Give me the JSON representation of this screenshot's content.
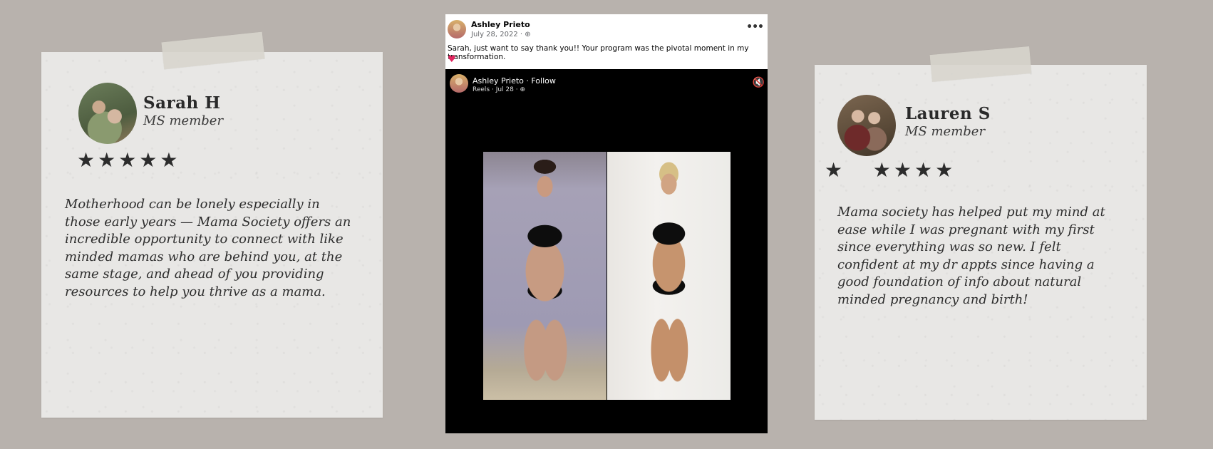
{
  "left_card": {
    "name": "Sarah H",
    "role": "MS member",
    "stars": "★★★★★",
    "quote": "Motherhood can be lonely especially in those early years — Mama Society offers an incredible opportunity to connect with like minded mamas who are behind you, at the same stage, and ahead of you providing resources to help you thrive as a mama."
  },
  "post": {
    "author": "Ashley Prieto",
    "meta": "July 28, 2022 · ⊕",
    "more": "•••",
    "text": "Sarah, just want to say thank you!! Your program was the pivotal moment in my transformation.",
    "heart": "♥",
    "reel_author": "Ashley Prieto · Follow",
    "reel_meta": "Reels · Jul 28 · ⊕",
    "mute": "🔇"
  },
  "right_card": {
    "name": "Lauren S",
    "role": "MS member",
    "stars": "★   ★★★★",
    "quote": "Mama society has helped put my mind at ease while I was pregnant with my first since everything was so new. I felt confident at my dr appts since having a good foundation of info about natural minded pregnancy and birth!"
  }
}
